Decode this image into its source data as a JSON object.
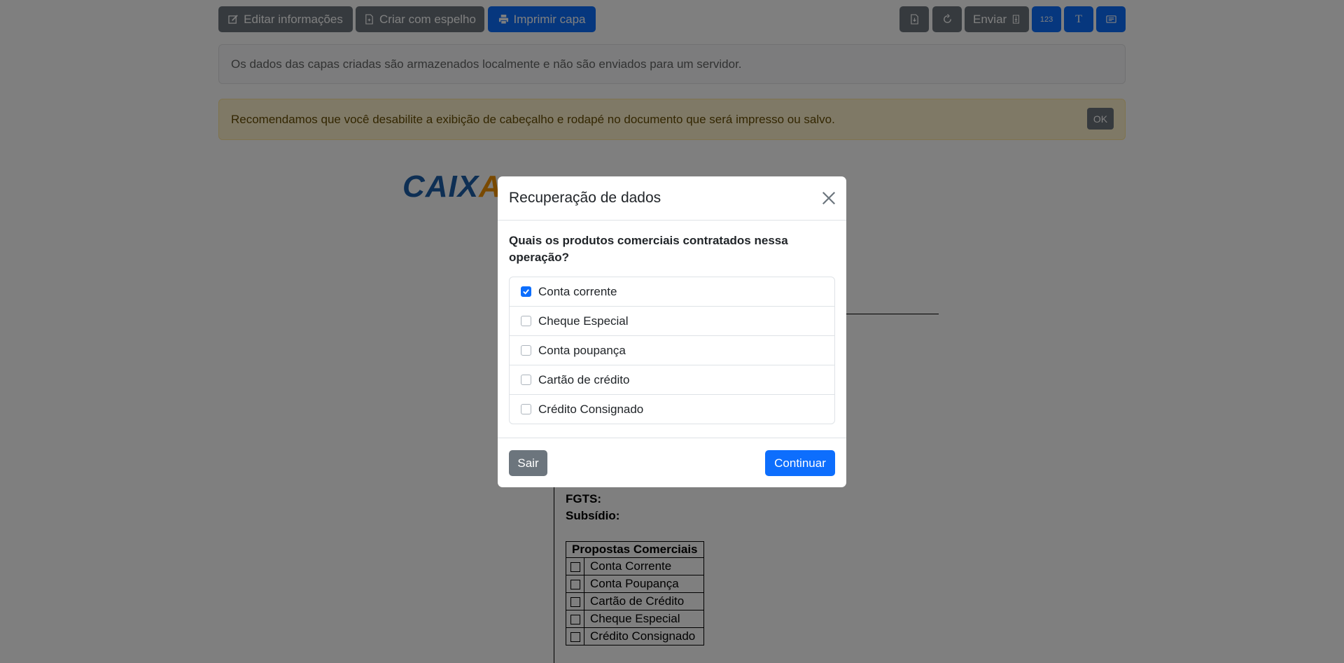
{
  "toolbar": {
    "edit_label": "Editar informações",
    "mirror_label": "Criar com espelho",
    "print_label": "Imprimir capa",
    "send_label": "Enviar",
    "numbers_label": "123",
    "text_label": "T"
  },
  "alerts": {
    "info": "Os dados das capas criadas são armazenados localmente e não são enviados para um servidor.",
    "warning": "Recomendamos que você desabilite a exibição de cabeçalho e rodapé no documento que será impresso ou salvo.",
    "ok_label": "OK"
  },
  "document": {
    "logo_main": "CAIX",
    "logo_accent": "A",
    "fgts_label": "FGTS:",
    "subsidio_label": "Subsídio:",
    "proposals_header": "Propostas Comerciais",
    "proposals": [
      "Conta Corrente",
      "Conta Poupança",
      "Cartão de Crédito",
      "Cheque Especial",
      "Crédito Consignado"
    ]
  },
  "modal": {
    "title": "Recuperação de dados",
    "question": "Quais os produtos comerciais contratados nessa operação?",
    "options": [
      {
        "label": "Conta corrente",
        "checked": true
      },
      {
        "label": "Cheque Especial",
        "checked": false
      },
      {
        "label": "Conta poupança",
        "checked": false
      },
      {
        "label": "Cartão de crédito",
        "checked": false
      },
      {
        "label": "Crédito Consignado",
        "checked": false
      }
    ],
    "exit_label": "Sair",
    "continue_label": "Continuar"
  },
  "colors": {
    "primary": "#0d6efd",
    "secondary": "#6c757d",
    "warning_bg": "#fff3cd",
    "logo_blue": "#1c5fa8",
    "logo_orange": "#f39200"
  }
}
